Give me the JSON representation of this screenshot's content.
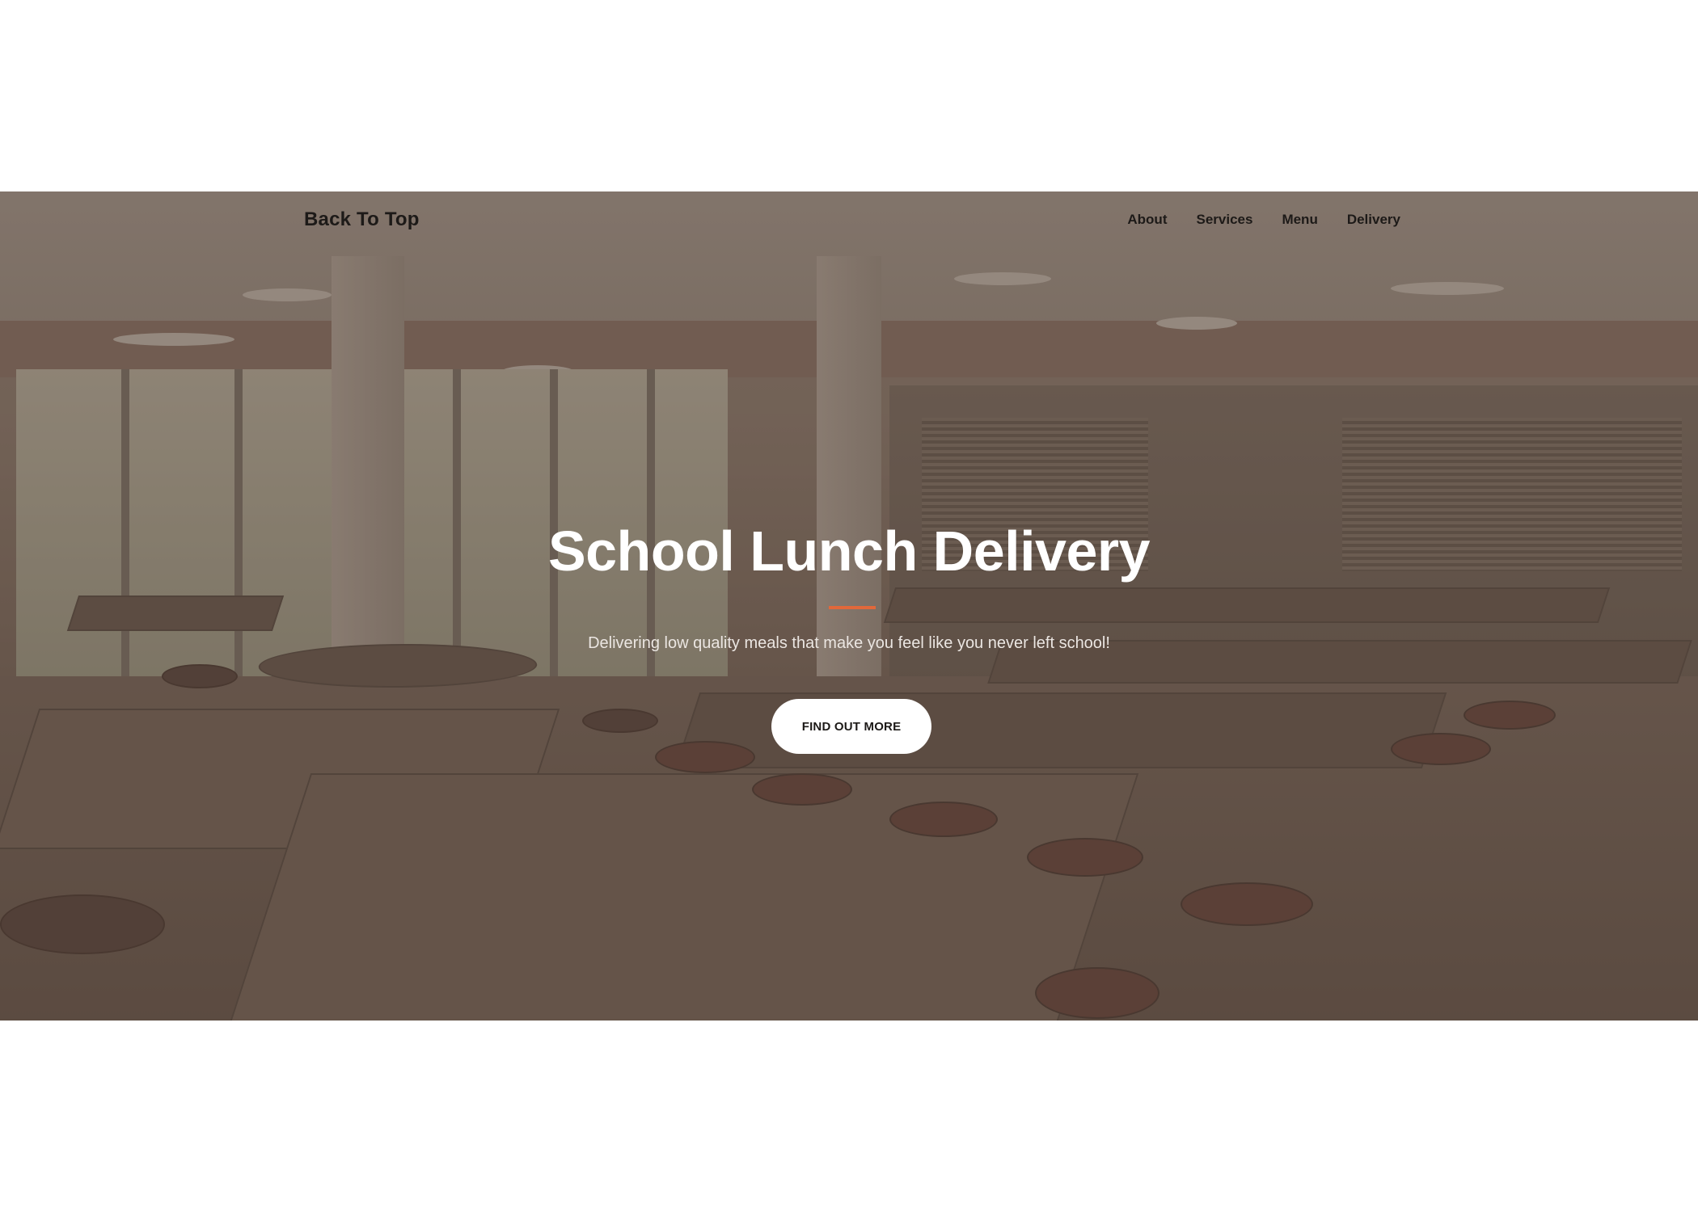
{
  "navbar": {
    "brand": "Back To Top",
    "links": [
      {
        "label": "About"
      },
      {
        "label": "Services"
      },
      {
        "label": "Menu"
      },
      {
        "label": "Delivery"
      }
    ]
  },
  "hero": {
    "title": "School Lunch Delivery",
    "subtitle": "Delivering low quality meals that make you feel like you never left school!",
    "cta_label": "FIND OUT MORE",
    "background_image": "cafeteria-photo",
    "divider_color": "#e2683a"
  }
}
